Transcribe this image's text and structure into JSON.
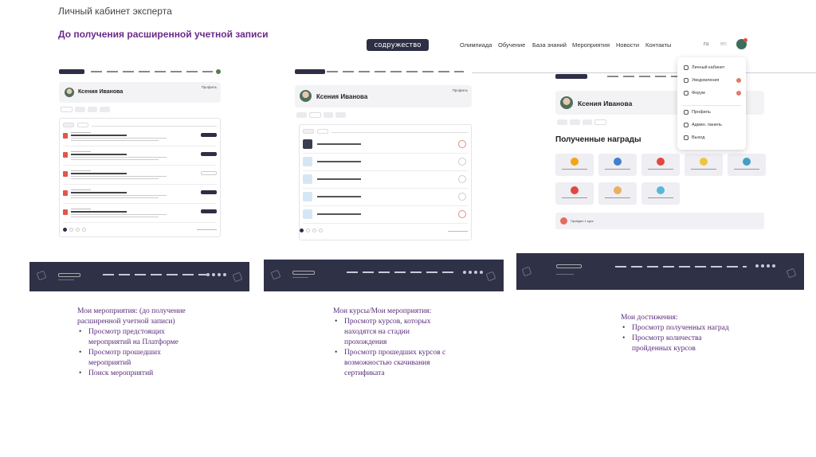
{
  "slide": {
    "title": "Личный кабинет эксперта",
    "subtitle": "До получения расширенной учетной записи"
  },
  "site_nav": {
    "logo": "содружество",
    "links": [
      "Олимпиада",
      "Обучение",
      "База знаний",
      "Мероприятия",
      "Новости",
      "Контакты"
    ],
    "lang_active": "ru",
    "lang_other": "en"
  },
  "user_menu": {
    "items": [
      {
        "label": "Личный кабинет",
        "icon": "user-icon",
        "badge": false
      },
      {
        "label": "Уведомления",
        "icon": "bell-icon",
        "badge": true
      },
      {
        "label": "Форум",
        "icon": "chat-icon",
        "badge": true
      },
      {
        "label": "Профиль",
        "icon": "user-circle-icon",
        "badge": false
      },
      {
        "label": "Админ. панель",
        "icon": "edit-icon",
        "badge": false
      },
      {
        "label": "Выход",
        "icon": "logout-icon",
        "badge": false
      }
    ]
  },
  "profile": {
    "name": "Ксения Иванова",
    "profile_link": "Профиль"
  },
  "achievements": {
    "awards_title": "Полученные награды",
    "passed_courses": "Пройден 1 курс",
    "award_colors": [
      "#f2a516",
      "#3f7fd0",
      "#e2483f",
      "#f0c53a",
      "#3fa0c8",
      "#e2483f",
      "#e8b060",
      "#58b8d8"
    ]
  },
  "descriptions": {
    "events": {
      "heading_line1": "Мои мероприятия: (до получение",
      "heading_line2": "расширенной учетной записи)",
      "bullets": [
        [
          "Просмотр предстоящих",
          "мероприятий на Платформе"
        ],
        [
          "Просмотр прошедших",
          "мероприятий"
        ],
        [
          "Поиск мероприятий"
        ]
      ]
    },
    "courses": {
      "heading": "Мои курсы/Мои мероприятия:",
      "bullets": [
        [
          "Просмотр курсов, которых",
          "находятся на стадии",
          "прохождения"
        ],
        [
          "Просмотр прошедших курсов с",
          "возможностью скачивания",
          "сертификата"
        ]
      ]
    },
    "achievements": {
      "heading": "Мои достижения:",
      "bullets": [
        [
          "Просмотр полученных наград"
        ],
        [
          "Просмотр количества",
          "пройденных курсов"
        ]
      ]
    }
  }
}
